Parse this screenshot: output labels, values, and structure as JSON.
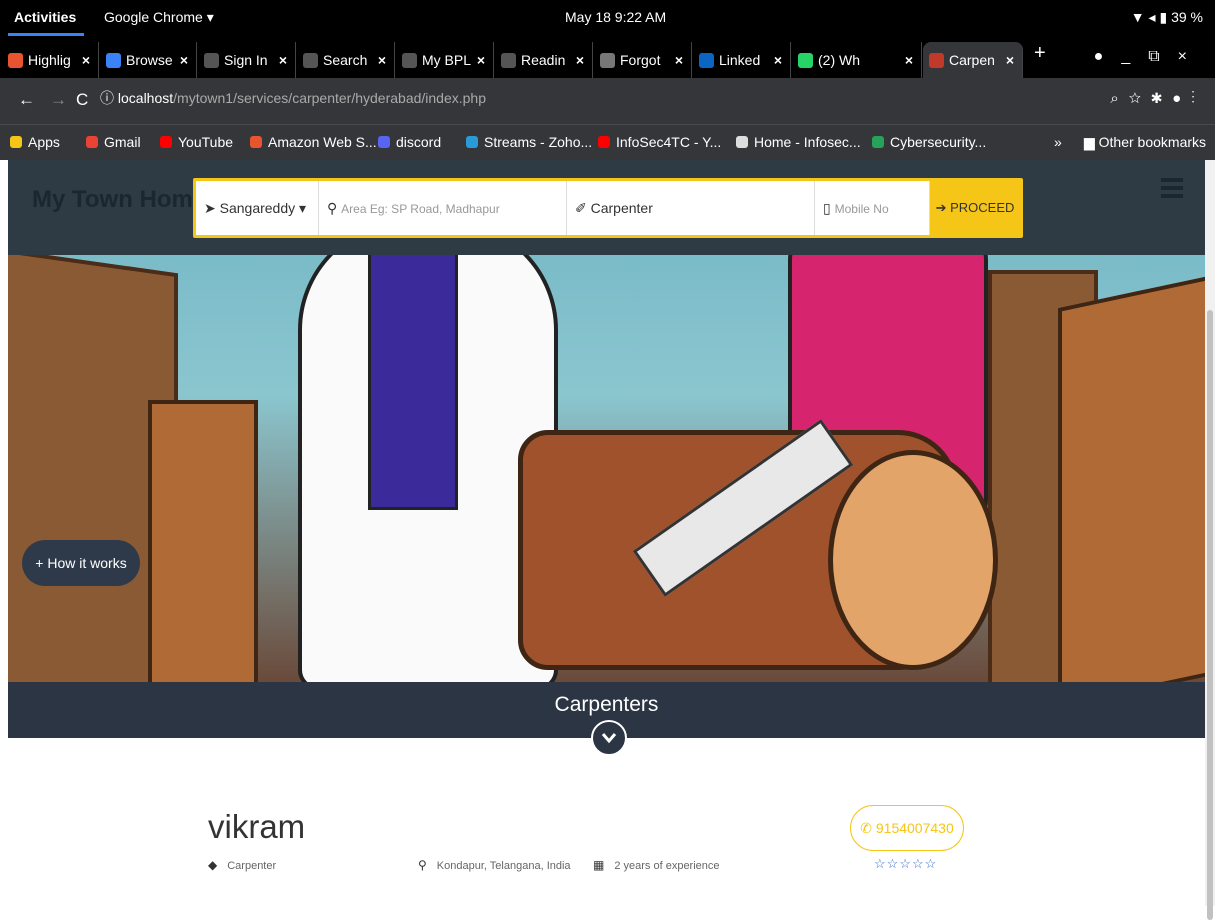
{
  "system_bar": {
    "activities": "Activities",
    "app_name": "Google Chrome ▾",
    "clock": "May 18  9:22 AM",
    "battery": "39 %"
  },
  "tabs": [
    {
      "label": "Highlig",
      "color": "#e8542f"
    },
    {
      "label": "Browse",
      "color": "#3b82f6"
    },
    {
      "label": "Sign In",
      "color": "#555555"
    },
    {
      "label": "Search",
      "color": "#555555"
    },
    {
      "label": "My BPL",
      "color": "#555555"
    },
    {
      "label": "Readin",
      "color": "#555555"
    },
    {
      "label": "Forgot",
      "color": "#777777"
    },
    {
      "label": "Linked",
      "color": "#0a66c2"
    },
    {
      "label": "(2) Wh",
      "color": "#25d366"
    },
    {
      "label": "Carpen",
      "color": "#c0392b"
    }
  ],
  "omnibox": {
    "host": "localhost",
    "path": "/mytown1/services/carpenter/hyderabad/index.php"
  },
  "bookmarks": [
    {
      "label": "Apps",
      "color": "#f5c518"
    },
    {
      "label": "Gmail",
      "color": "#ea4335"
    },
    {
      "label": "YouTube",
      "color": "#ff0000"
    },
    {
      "label": "Amazon Web S...",
      "color": "#e8542f"
    },
    {
      "label": "discord",
      "color": "#5865f2"
    },
    {
      "label": "Streams - Zoho...",
      "color": "#2b9bd8"
    },
    {
      "label": "InfoSec4TC - Y...",
      "color": "#ff0000"
    },
    {
      "label": "Home - Infosec...",
      "color": "#dddddd"
    },
    {
      "label": "Cybersecurity...",
      "color": "#25a35a"
    }
  ],
  "bookmarks_other": "Other bookmarks",
  "site": {
    "brand": "My Town Home",
    "search": {
      "city": "Sangareddy",
      "area_placeholder": "Area Eg: SP Road, Madhapur",
      "service": "Carpenter",
      "mobile_placeholder": "Mobile No",
      "proceed": "PROCEED"
    },
    "how_it_works": "+ How it works",
    "category_title": "Carpenters",
    "listing": {
      "name": "vikram",
      "profession": "Carpenter",
      "location": "Kondapur, Telangana, India",
      "experience": "2 years of experience",
      "phone": "9154007430",
      "stars": "☆☆☆☆☆"
    }
  }
}
